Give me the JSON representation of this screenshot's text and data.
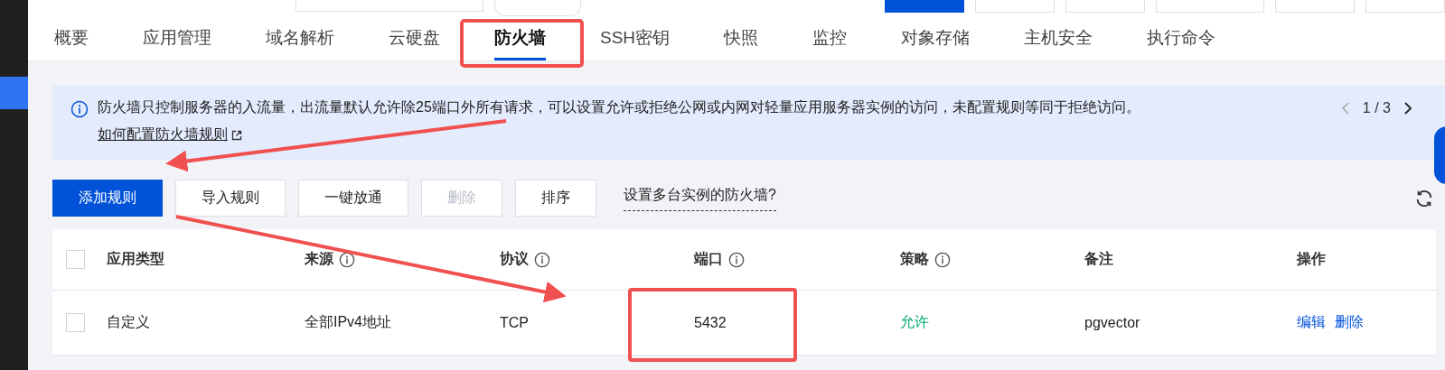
{
  "tabs": [
    {
      "label": "概要",
      "selected": false
    },
    {
      "label": "应用管理",
      "selected": false
    },
    {
      "label": "域名解析",
      "selected": false
    },
    {
      "label": "云硬盘",
      "selected": false
    },
    {
      "label": "防火墙",
      "selected": true
    },
    {
      "label": "SSH密钥",
      "selected": false
    },
    {
      "label": "快照",
      "selected": false
    },
    {
      "label": "监控",
      "selected": false
    },
    {
      "label": "对象存储",
      "selected": false
    },
    {
      "label": "主机安全",
      "selected": false
    },
    {
      "label": "执行命令",
      "selected": false
    }
  ],
  "notice": {
    "text": "防火墙只控制服务器的入流量，出流量默认允许除25端口外所有请求，可以设置允许或拒绝公网或内网对轻量应用服务器实例的访问，未配置规则等同于拒绝访问。",
    "link": "如何配置防火墙规则",
    "pager": "1 / 3"
  },
  "toolbar": {
    "buttons": [
      {
        "label": "添加规则",
        "kind": "primary",
        "disabled": false
      },
      {
        "label": "导入规则",
        "kind": "default",
        "disabled": false
      },
      {
        "label": "一键放通",
        "kind": "default",
        "disabled": false
      },
      {
        "label": "删除",
        "kind": "default",
        "disabled": true
      },
      {
        "label": "排序",
        "kind": "default",
        "disabled": false
      }
    ],
    "link": "设置多台实例的防火墙?"
  },
  "table": {
    "all_checked": false,
    "columns": [
      {
        "label": "应用类型",
        "info": false
      },
      {
        "label": "来源",
        "info": true
      },
      {
        "label": "协议",
        "info": true
      },
      {
        "label": "端口",
        "info": true
      },
      {
        "label": "策略",
        "info": true
      },
      {
        "label": "备注",
        "info": false
      },
      {
        "label": "操作",
        "info": false
      }
    ],
    "rows": [
      {
        "checked": false,
        "app_type": "自定义",
        "source": "全部IPv4地址",
        "protocol": "TCP",
        "port": "5432",
        "policy": "允许",
        "note": "pgvector",
        "actions": [
          "编辑",
          "删除"
        ]
      }
    ]
  }
}
